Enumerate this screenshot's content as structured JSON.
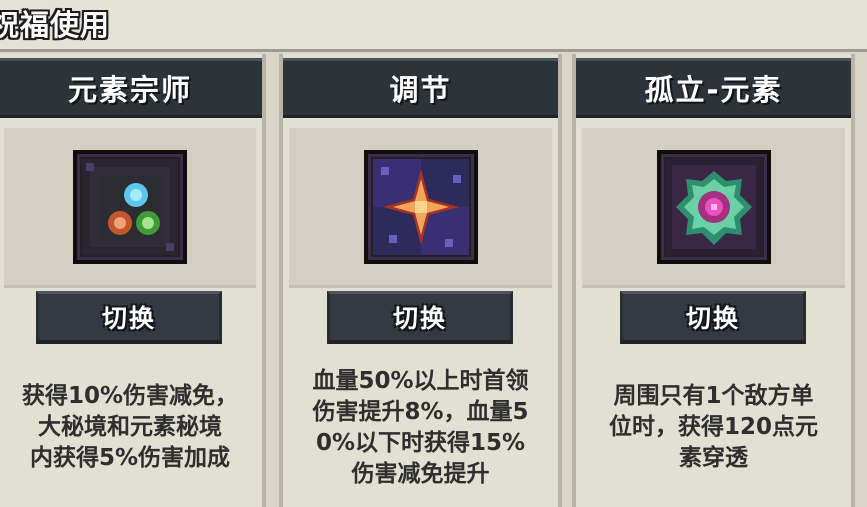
{
  "section": {
    "title": "祝福使用"
  },
  "cards": [
    {
      "title": "元素宗师",
      "icon": "element-master-icon",
      "button_label": "切换",
      "description_lines": [
        "获得10%伤害减免，",
        "大秘境和元素秘境",
        "内获得5%伤害加成"
      ]
    },
    {
      "title": "调节",
      "icon": "adjust-star-icon",
      "button_label": "切换",
      "description_lines": [
        "血量50%以上时首领",
        "伤害提升8%，血量5",
        "0%以下时获得15%",
        "伤害减免提升"
      ]
    },
    {
      "title": "孤立-元素",
      "icon": "isolation-element-icon",
      "button_label": "切换",
      "description_lines": [
        "周围只有1个敌方单",
        "位时，获得120点元",
        "素穿透"
      ]
    }
  ],
  "colors": {
    "header_bg": "#2c3339",
    "button_bg": "#333a41",
    "panel_bg": "#e2dfd3",
    "text_dark": "#2e2e2e"
  }
}
